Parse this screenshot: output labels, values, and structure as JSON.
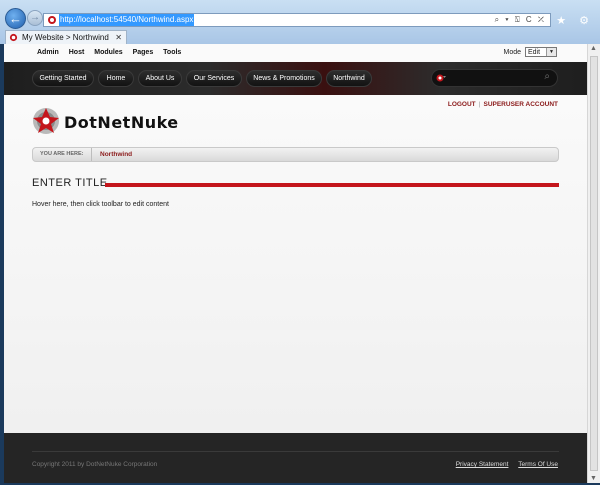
{
  "browser": {
    "url": "http://localhost:54540/Northwind.aspx",
    "tab_title": "My Website > Northwind",
    "tab_close": "✕",
    "address_controls": "⌕ ▾ ⍂ C ✕",
    "toolbar_icons": "⌂ ★ ⚙"
  },
  "control_bar": {
    "menu": [
      "Admin",
      "Host",
      "Modules",
      "Pages",
      "Tools"
    ],
    "mode_label": "Mode",
    "mode_value": "Edit"
  },
  "nav": {
    "items": [
      "Getting Started",
      "Home",
      "About Us",
      "Our Services",
      "News & Promotions",
      "Northwind"
    ]
  },
  "header": {
    "logout": "LOGOUT",
    "account": "SUPERUSER ACCOUNT",
    "logo_text": "DotNetNuke"
  },
  "breadcrumb": {
    "label": "YOU ARE HERE:",
    "page": "Northwind"
  },
  "content": {
    "title": "ENTER TITLE",
    "hint": "Hover here, then click toolbar to edit content"
  },
  "footer": {
    "copyright": "Copyright 2011 by DotNetNuke Corporation",
    "privacy": "Privacy Statement",
    "terms": "Terms Of Use"
  },
  "colors": {
    "accent_red": "#c4161c",
    "link_red": "#8b1a1a",
    "nav_bg": "#1e1e1e",
    "footer_bg": "#252525"
  }
}
